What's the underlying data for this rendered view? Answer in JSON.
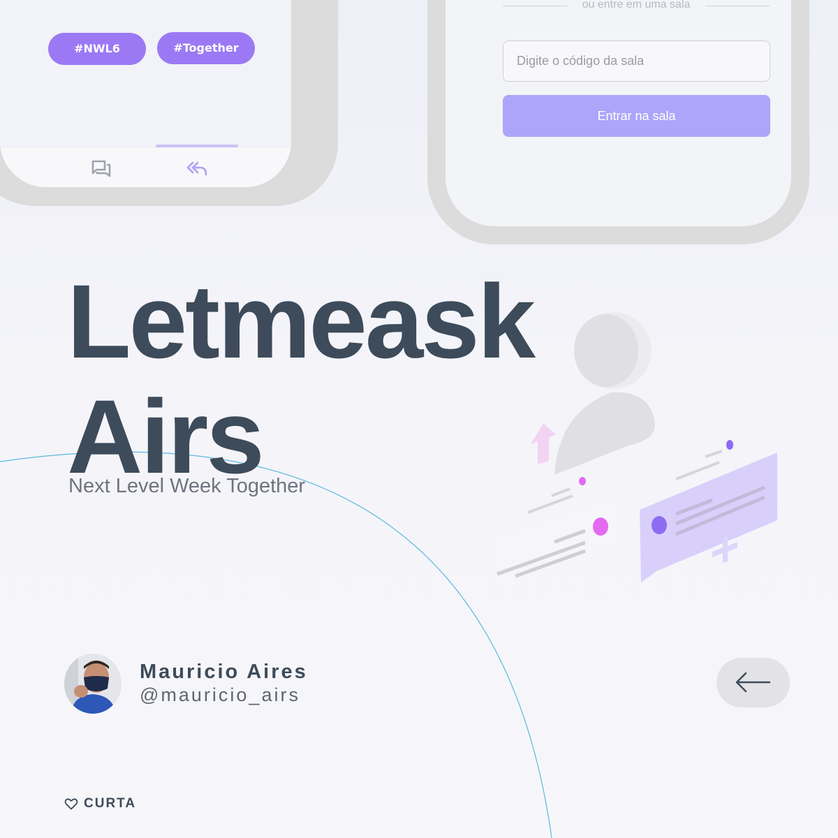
{
  "left_phone": {
    "tags": [
      "#NWL6",
      "#Together"
    ],
    "tabs": [
      {
        "icon": "chat-bubbles-icon",
        "active": false
      },
      {
        "icon": "reply-all-icon",
        "active": true
      }
    ]
  },
  "right_phone": {
    "divider_text": "ou entre em uma sala",
    "room_input_placeholder": "Digite o código da sala",
    "enter_button_label": "Entrar na sala"
  },
  "hero": {
    "title_line1": "Letmeask",
    "title_line2": "Airs",
    "subtitle": "Next Level Week Together"
  },
  "author": {
    "name": "Mauricio Aires",
    "handle": "@mauricio_airs"
  },
  "actions": {
    "back_icon": "arrow-left-icon",
    "like_icon": "heart-icon",
    "like_label": "CURTA"
  },
  "colors": {
    "accent": "#9b79f4",
    "button": "#aca5fa",
    "title": "#3d4b5a",
    "arc": "#5bb8de"
  }
}
